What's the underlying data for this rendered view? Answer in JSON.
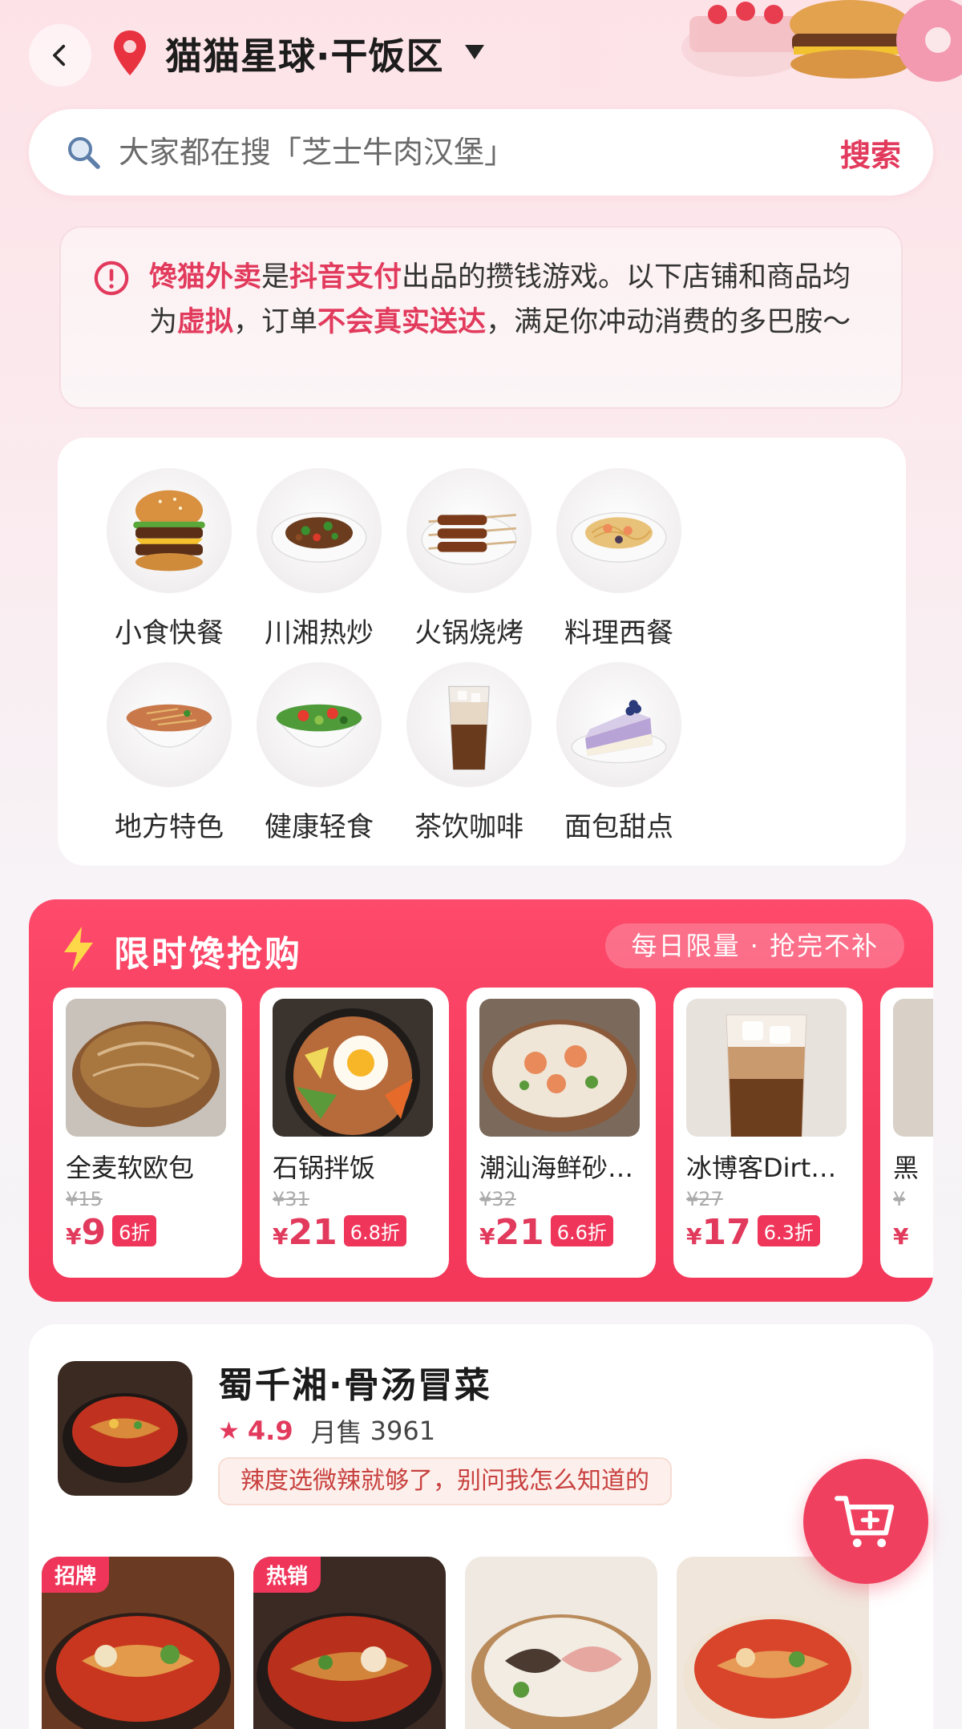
{
  "header": {
    "location_title": "猫猫星球·干饭区"
  },
  "search": {
    "placeholder": "大家都在搜「芝士牛肉汉堡」",
    "button_label": "搜索"
  },
  "notice": {
    "brand": "馋猫外卖",
    "t1": "是",
    "pay": "抖音支付",
    "t2": "出品的攒钱游戏。以下店铺和商品均为",
    "virtual": "虚拟",
    "t3": "，订单",
    "no_delivery": "不会真实送达",
    "t4": "，满足你冲动消费的多巴胺～"
  },
  "categories": [
    {
      "label": "小食快餐",
      "icon": "burger-icon"
    },
    {
      "label": "川湘热炒",
      "icon": "stir-fry-icon"
    },
    {
      "label": "火锅烧烤",
      "icon": "skewers-icon"
    },
    {
      "label": "料理西餐",
      "icon": "pasta-icon"
    },
    {
      "label": "地方特色",
      "icon": "noodle-bowl-icon"
    },
    {
      "label": "健康轻食",
      "icon": "salad-icon"
    },
    {
      "label": "茶饮咖啡",
      "icon": "coffee-icon"
    },
    {
      "label": "面包甜点",
      "icon": "cake-icon"
    }
  ],
  "flash_sale": {
    "title": "限时馋抢购",
    "tag": "每日限量 · 抢完不补",
    "items": [
      {
        "name": "全麦软欧包",
        "orig": "¥15",
        "price": "9",
        "discount": "6折"
      },
      {
        "name": "石锅拌饭",
        "orig": "¥31",
        "price": "21",
        "discount": "6.8折"
      },
      {
        "name": "潮汕海鲜砂…",
        "orig": "¥32",
        "price": "21",
        "discount": "6.6折"
      },
      {
        "name": "冰博客Dirt…",
        "orig": "¥27",
        "price": "17",
        "discount": "6.3折"
      },
      {
        "name": "黑",
        "orig": "¥",
        "price": "",
        "discount": ""
      }
    ],
    "currency": "¥"
  },
  "store": {
    "name": "蜀千湘·骨汤冒菜",
    "rating": "4.9",
    "sales_label": "月售",
    "sales": "3961",
    "tip": "辣度选微辣就够了，别问我怎么知道的",
    "dishes": [
      {
        "badge": "招牌"
      },
      {
        "badge": "热销"
      },
      {
        "badge": ""
      },
      {
        "badge": ""
      }
    ]
  },
  "colors": {
    "accent": "#e23a5c",
    "flash_bg": "#f43a5d"
  }
}
